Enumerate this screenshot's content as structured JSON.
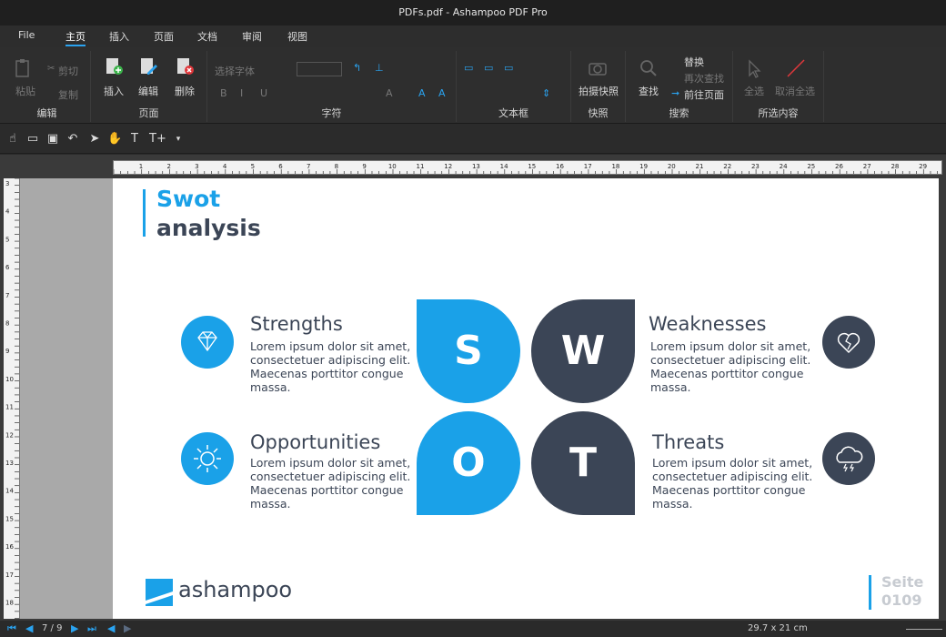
{
  "window": {
    "title": "PDFs.pdf - Ashampoo PDF Pro"
  },
  "menu": {
    "items": [
      "File",
      "主页",
      "插入",
      "页面",
      "文档",
      "审阅",
      "视图"
    ],
    "active_index": 1
  },
  "ribbon": {
    "edit_group": {
      "title": "编辑",
      "paste": "粘贴",
      "cut": "剪切",
      "copy": "复制"
    },
    "page_group": {
      "title": "页面",
      "insert": "插入",
      "edit": "编辑",
      "delete": "删除"
    },
    "char_group": {
      "title": "字符",
      "font_placeholder": "选择字体"
    },
    "textbox_group": {
      "title": "文本框"
    },
    "snapshot_group": {
      "title": "快照",
      "snapshot": "拍摄快照"
    },
    "search_group": {
      "title": "搜索",
      "find": "查找",
      "replace": "替换",
      "find_next": "再次查找",
      "goto_page": "前往页面"
    },
    "selection_group": {
      "title": "所选内容",
      "select_all": "全选",
      "deselect_all": "取消全选"
    }
  },
  "ruler": {
    "h_marks": [
      "1",
      "2",
      "3",
      "4",
      "5",
      "6",
      "7",
      "8",
      "9",
      "10",
      "11",
      "12",
      "13",
      "14",
      "15",
      "16",
      "17",
      "18",
      "19",
      "20",
      "21",
      "22",
      "23",
      "24",
      "25",
      "26",
      "27",
      "28",
      "29"
    ],
    "v_marks": [
      "3",
      "4",
      "5",
      "6",
      "7",
      "8",
      "9",
      "10",
      "11",
      "12",
      "13",
      "14",
      "15",
      "16",
      "17",
      "18"
    ]
  },
  "slide": {
    "title_line1": "Swot",
    "title_line2": "analysis",
    "strengths": {
      "title": "Strengths",
      "text": "Lorem ipsum dolor sit amet, consectetuer adipiscing elit. Maecenas porttitor congue massa."
    },
    "weaknesses": {
      "title": "Weaknesses",
      "text": "Lorem ipsum dolor sit amet, consectetuer adipiscing elit. Maecenas porttitor congue massa."
    },
    "opportunities": {
      "title": "Opportunities",
      "text": "Lorem ipsum dolor sit amet, consectetuer adipiscing elit. Maecenas porttitor congue massa."
    },
    "threats": {
      "title": "Threats",
      "text": "Lorem ipsum dolor sit amet, consectetuer adipiscing elit. Maecenas porttitor congue massa."
    },
    "letters": {
      "s": "S",
      "w": "W",
      "o": "O",
      "t": "T"
    },
    "logo_text": "ashampoo",
    "page_label": "Seite",
    "page_number": "0109",
    "colors": {
      "accent": "#1aa1e8",
      "dark": "#3b4556"
    }
  },
  "status": {
    "page_indicator": "7 / 9",
    "page_size": "29.7 x 21 cm"
  }
}
